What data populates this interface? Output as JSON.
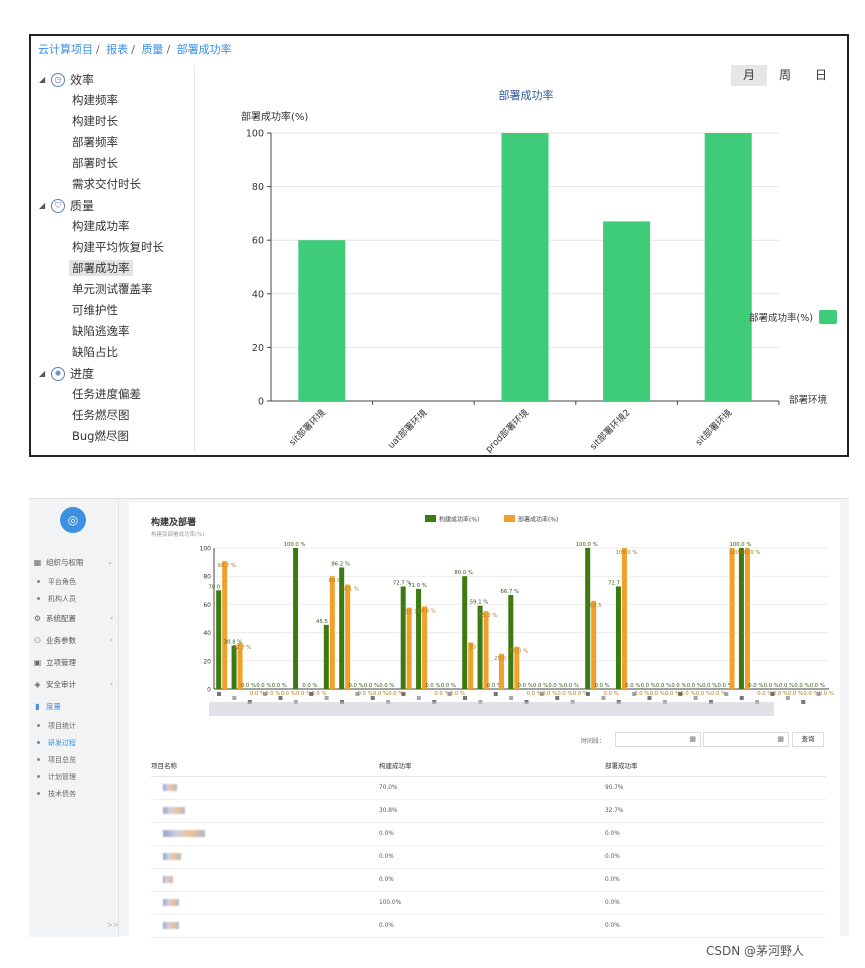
{
  "panel1": {
    "breadcrumb": [
      "云计算项目",
      "报表",
      "质量",
      "部署成功率"
    ],
    "periods": [
      {
        "label": "月",
        "active": true
      },
      {
        "label": "周",
        "active": false
      },
      {
        "label": "日",
        "active": false
      }
    ],
    "tree": [
      {
        "label": "效率",
        "icon": "clock-icon",
        "glyph": "◷",
        "items": [
          "构建频率",
          "构建时长",
          "部署频率",
          "部署时长",
          "需求交付时长"
        ]
      },
      {
        "label": "质量",
        "icon": "shield-icon",
        "glyph": "⛉",
        "items": [
          "构建成功率",
          "构建平均恢复时长",
          "部署成功率",
          "单元测试覆盖率",
          "可维护性",
          "缺陷逃逸率",
          "缺陷占比"
        ]
      },
      {
        "label": "进度",
        "icon": "gear-icon",
        "glyph": "✺",
        "items": [
          "任务进度偏差",
          "任务燃尽图",
          "Bug燃尽图"
        ]
      }
    ],
    "active_item": "部署成功率"
  },
  "chart_data": [
    {
      "type": "bar",
      "title": "部署成功率",
      "ylabel": "部署成功率(%)",
      "xlabel": "部署环境",
      "categories": [
        "sit部署环境",
        "uat部署环境",
        "prod部署环境",
        "sit部署环境2",
        "sit部署环境"
      ],
      "series": [
        {
          "name": "部署成功率(%)",
          "values": [
            60,
            0,
            100,
            67,
            100
          ],
          "color": "#3ecc78"
        }
      ],
      "ylim": [
        0,
        100
      ],
      "yticks": [
        0,
        20,
        40,
        60,
        80,
        100
      ],
      "grid": true,
      "legend": "right"
    },
    {
      "type": "bar",
      "title": "构建及部署",
      "subtitle": "构建及部署成功率(%)",
      "series": [
        {
          "name": "构建成功率(%)",
          "color": "#3d7a10",
          "values": [
            70,
            30.8,
            0,
            0,
            0,
            100,
            0,
            45.5,
            86.2,
            0,
            0,
            0,
            72.7,
            71,
            0,
            0,
            80,
            59.1,
            0,
            66.7,
            0,
            0,
            0,
            0,
            100,
            0,
            72.7,
            0,
            0,
            0,
            0,
            0,
            0,
            0,
            100,
            0,
            0,
            0,
            0,
            0
          ],
          "labels": [
            "70.0 %",
            "30.8 %",
            "0.0 %",
            "0.0 %",
            "0.0 %",
            "100.0 %",
            "0.0 %",
            "45.5 %",
            "86.2 %",
            "0.0 %",
            "0.0 %",
            "0.0 %",
            "72.7 %",
            "71.0 %",
            "0.0 %",
            "0.0 %",
            "80.0 %",
            "59.1 %",
            "0.0 %",
            "66.7 %",
            "0.0 %",
            "0.0 %",
            "0.0 %",
            "0.0 %",
            "100.0 %",
            "0.0 %",
            "72.7 %",
            "0.0 %",
            "0.0 %",
            "0.0 %",
            "0.0 %",
            "0.0 %",
            "0.0 %",
            "0.0 %",
            "100.0 %",
            "0.0 %",
            "0.0 %",
            "0.0 %",
            "0.0 %",
            "0.0 %"
          ]
        },
        {
          "name": "部署成功率(%)",
          "color": "#f0a12c",
          "values": [
            90.7,
            32.7,
            0,
            0,
            0,
            0,
            0,
            80,
            74.1,
            0,
            0,
            0,
            57.7,
            58.6,
            0,
            0,
            33,
            55.2,
            25,
            30,
            0,
            0,
            0,
            0,
            62.5,
            0,
            100,
            0,
            0,
            0,
            0,
            0,
            0,
            100,
            100,
            0,
            0,
            0,
            0,
            0
          ],
          "labels": [
            "90.7 %",
            "32.7 %",
            "0.0 %",
            "0.0 %",
            "0.0 %",
            "0.0 %",
            "0.0 %",
            "80.0",
            "74.1 %",
            "0.0 %",
            "0.0 %",
            "0.0 %",
            "57.7",
            "58.6 %",
            "0.0 %",
            "0.0 %",
            "33",
            "55.2 %",
            "25.0 %",
            "30.0 %",
            "0.0 %",
            "0.0 %",
            "0.0 %",
            "0.0 %",
            "62.5",
            "0.0 %",
            "100.0 %",
            "0.0 %",
            "0.0 %",
            "0.0 %",
            "0.0 %",
            "0.0 %",
            "0.0 %",
            "100",
            "100.0 %",
            "0.0 %",
            "0.0 %",
            "0.0 %",
            "0.0 %",
            "0.0 %"
          ]
        }
      ],
      "ylim": [
        0,
        100
      ],
      "yticks": [
        0,
        20,
        40,
        60,
        80,
        100
      ],
      "grid": true,
      "legend": "top"
    }
  ],
  "panel2": {
    "nav": [
      {
        "label": "组织与权限",
        "icon": "org-icon",
        "glyph": "▦",
        "chevron": "⌄",
        "active": false,
        "sub": [
          "平台角色",
          "机构人员"
        ]
      },
      {
        "label": "系统配置",
        "icon": "gear-icon",
        "glyph": "⚙",
        "chevron": "‹",
        "active": false,
        "sub": []
      },
      {
        "label": "业务参数",
        "icon": "params-icon",
        "glyph": "⚇",
        "chevron": "‹",
        "active": false,
        "sub": []
      },
      {
        "label": "立项管理",
        "icon": "project-icon",
        "glyph": "▣",
        "chevron": "",
        "active": false,
        "sub": []
      },
      {
        "label": "安全审计",
        "icon": "shield-icon",
        "glyph": "◈",
        "chevron": "‹",
        "active": false,
        "sub": []
      },
      {
        "label": "度量",
        "icon": "bar-chart-icon",
        "glyph": "▮",
        "chevron": "",
        "active": true,
        "sub": [
          "项目统计",
          "研发过程",
          "项目总览",
          "计划管理",
          "技术债务"
        ]
      }
    ],
    "active_sub": "研发过程",
    "title": "构建及部署",
    "subtitle": "构建及部署成功率(%)",
    "filter_label": "时间段：",
    "query_label": "查询",
    "table": {
      "headers": [
        "项目名称",
        "构建成功率",
        "部署成功率"
      ],
      "rows": [
        [
          "70.0%",
          "90.7%"
        ],
        [
          "30.8%",
          "32.7%"
        ],
        [
          "0.0%",
          "0.0%"
        ],
        [
          "0.0%",
          "0.0%"
        ],
        [
          "0.0%",
          "0.0%"
        ],
        [
          "100.0%",
          "0.0%"
        ],
        [
          "0.0%",
          "0.0%"
        ]
      ]
    }
  },
  "watermark": "CSDN @茅河野人"
}
